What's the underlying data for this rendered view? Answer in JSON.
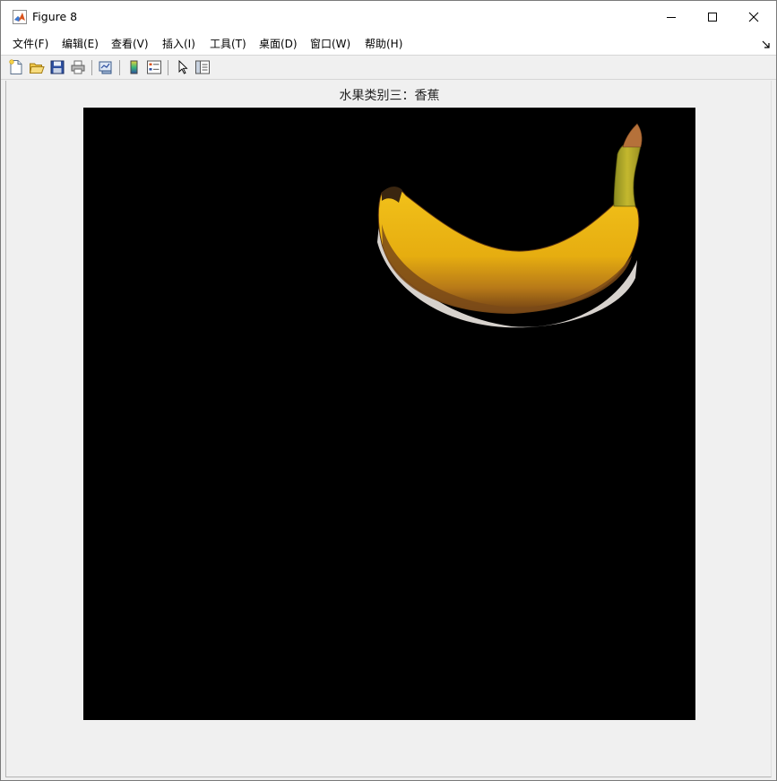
{
  "window": {
    "title": "Figure 8"
  },
  "menu": {
    "items": [
      "文件(F)",
      "编辑(E)",
      "查看(V)",
      "插入(I)",
      "工具(T)",
      "桌面(D)",
      "窗口(W)",
      "帮助(H)"
    ]
  },
  "toolbar": {
    "buttons": [
      "new-figure-icon",
      "open-file-icon",
      "save-icon",
      "print-icon",
      "link-plot-icon",
      "insert-colorbar-icon",
      "insert-legend-icon",
      "edit-plot-arrow-icon",
      "property-inspector-icon"
    ]
  },
  "axes": {
    "title": "水果类别三：香蕉",
    "image_content": "banana",
    "background_color": "#000000"
  },
  "colors": {
    "banana_yellow": "#e8b514",
    "banana_dark": "#6a3d14",
    "window_bg": "#f0f0f0"
  }
}
